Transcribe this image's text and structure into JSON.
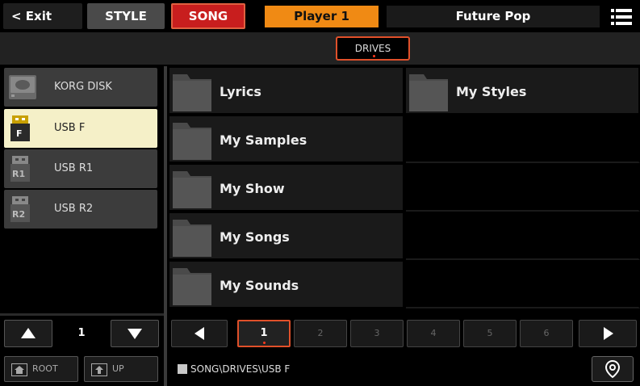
{
  "topbar": {
    "exit_label": "< Exit",
    "style_label": "STYLE",
    "song_label": "SONG",
    "player_label": "Player 1",
    "song_name": "Future Pop"
  },
  "drives_bar": {
    "drives_label": "DRIVES"
  },
  "drives": [
    {
      "label": "KORG DISK",
      "icon": "hard-disk-icon",
      "selected": false
    },
    {
      "label": "USB F",
      "icon": "usb-f-icon",
      "badge": "F",
      "selected": true
    },
    {
      "label": "USB R1",
      "icon": "usb-r1-icon",
      "badge": "R1",
      "selected": false
    },
    {
      "label": "USB R2",
      "icon": "usb-r2-icon",
      "badge": "R2",
      "selected": false
    }
  ],
  "files": [
    {
      "label": "Lyrics",
      "icon": "folder-icon"
    },
    {
      "label": "My Styles",
      "icon": "folder-icon"
    },
    {
      "label": "My Samples",
      "icon": "folder-icon"
    },
    {
      "label": "My Show",
      "icon": "folder-icon"
    },
    {
      "label": "My Songs",
      "icon": "folder-icon"
    },
    {
      "label": "My Sounds",
      "icon": "folder-icon"
    }
  ],
  "left_pager": {
    "value": "1"
  },
  "pages": [
    "1",
    "2",
    "3",
    "4",
    "5",
    "6"
  ],
  "active_page": "1",
  "bottom": {
    "root_label": "ROOT",
    "up_label": "UP",
    "path": "SONG\\DRIVES\\USB F"
  },
  "colors": {
    "accent": "#e0502a",
    "song_red": "#c81e1e",
    "player_orange": "#f08a14",
    "selected_item": "#f5f0c8"
  }
}
